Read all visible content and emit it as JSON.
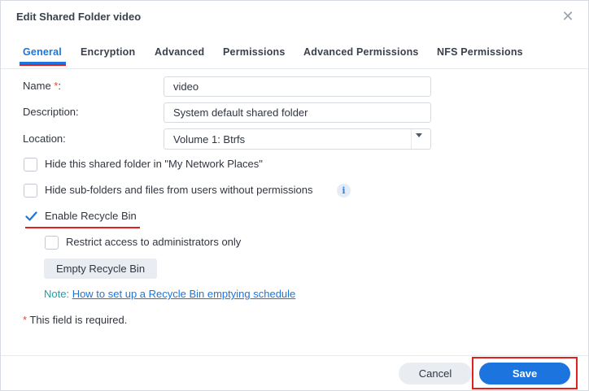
{
  "dialog": {
    "title": "Edit Shared Folder video",
    "close_glyph": "✕"
  },
  "tabs": [
    {
      "label": "General",
      "active": true
    },
    {
      "label": "Encryption",
      "active": false
    },
    {
      "label": "Advanced",
      "active": false
    },
    {
      "label": "Permissions",
      "active": false
    },
    {
      "label": "Advanced Permissions",
      "active": false
    },
    {
      "label": "NFS Permissions",
      "active": false
    }
  ],
  "form": {
    "name_label": "Name ",
    "required_mark": "*",
    "name_colon": ":",
    "name_value": "video",
    "description_label": "Description:",
    "description_value": "System default shared folder",
    "location_label": "Location:",
    "location_value": "Volume 1:  Btrfs"
  },
  "options": {
    "hide_network_places": {
      "label": "Hide this shared folder in \"My Network Places\"",
      "checked": false
    },
    "hide_subfolders": {
      "label": "Hide sub-folders and files from users without permissions",
      "checked": false
    },
    "enable_recycle_bin": {
      "label": "Enable Recycle Bin",
      "checked": true
    },
    "restrict_admins": {
      "label": "Restrict access to administrators only",
      "checked": false
    }
  },
  "recycle": {
    "empty_button": "Empty Recycle Bin",
    "note_prefix": "Note: ",
    "note_link": "How to set up a Recycle Bin emptying schedule"
  },
  "required_note": {
    "mark": "*",
    "text": " This field is required."
  },
  "footer": {
    "cancel": "Cancel",
    "save": "Save"
  },
  "icons": {
    "info": "i"
  },
  "colors": {
    "accent": "#1c74de",
    "annotation_red": "#e2211c",
    "required": "#e54b2c"
  }
}
